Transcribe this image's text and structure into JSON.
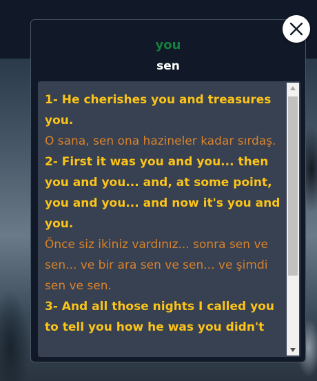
{
  "dialog": {
    "word": "you",
    "translation": "sen",
    "close_icon": "close-icon"
  },
  "examples": [
    {
      "english": "1- He cherishes you and treasures you.",
      "turkish": "O sana, sen ona hazineler kadar sırdaş."
    },
    {
      "english": "2- First it was you and you... then you and you... and, at some point, you and you... and now it's you and you.",
      "turkish": "Önce siz ikiniz vardınız... sonra sen ve sen... ve bir ara sen ve sen... ve şimdi sen ve sen."
    },
    {
      "english": "3- And all those nights I called you to tell you how he was you didn't",
      "turkish": ""
    }
  ],
  "colors": {
    "word": "#15803d",
    "english": "#fcc419",
    "turkish": "#d9822b",
    "panel": "#374151",
    "modal": "#111827"
  }
}
